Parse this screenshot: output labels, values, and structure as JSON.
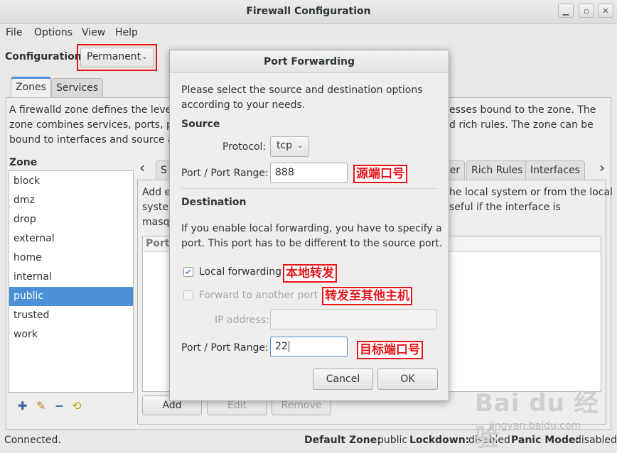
{
  "window": {
    "title": "Firewall Configuration"
  },
  "menu": [
    "File",
    "Options",
    "View",
    "Help"
  ],
  "configuration": {
    "label": "Configuration:",
    "value": "Permanent"
  },
  "tabs": [
    "Zones",
    "Services"
  ],
  "zone_description": [
    "A firewalld zone defines the level",
    "zone combines services, ports, pro",
    "bound to interfaces and source add"
  ],
  "zone_description_right": [
    "esses bound to the zone. The",
    "d rich rules. The zone can be"
  ],
  "zone_panel": {
    "title": "Zone",
    "items": [
      "block",
      "dmz",
      "drop",
      "external",
      "home",
      "internal",
      "public",
      "trusted",
      "work"
    ],
    "selected": "public"
  },
  "subtabs": {
    "first": "S",
    "partial": "cer",
    "rich_rules": "Rich Rules",
    "interfaces": "Interfaces"
  },
  "right_panel": {
    "left_text": [
      "Add e",
      "syster",
      "masqu"
    ],
    "right_text": [
      "he local system or from the local",
      "seful if the interface is"
    ],
    "column": "Port"
  },
  "bottom_buttons": {
    "add": "Add",
    "edit": "Edit",
    "remove": "Remove"
  },
  "status": {
    "text": "Connected.",
    "default_zone_label": "Default Zone:",
    "default_zone": "public",
    "lockdown_label": "Lockdown:",
    "lockdown": "disabled",
    "panic_label": "Panic Mode:",
    "panic": "disabled"
  },
  "dialog": {
    "title": "Port Forwarding",
    "intro": [
      "Please select the source and destination options",
      "according to your needs."
    ],
    "source_heading": "Source",
    "protocol_label": "Protocol:",
    "protocol_value": "tcp",
    "port_label": "Port / Port Range:",
    "source_port": "888",
    "destination_heading": "Destination",
    "dest_text": [
      "If you enable local forwarding, you have to specify a",
      "port. This port has to be different to the source port."
    ],
    "local_forwarding_label": "Local forwarding",
    "local_forwarding_checked": true,
    "forward_other_label": "Forward to another port",
    "ip_label": "IP address:",
    "ip_value": "",
    "dest_port_label": "Port / Port Range:",
    "dest_port": "22",
    "cancel": "Cancel",
    "ok": "OK"
  },
  "annotations": {
    "source_port": "源端口号",
    "local_forwarding": "本地转发",
    "forward_other": "转发至其他主机",
    "dest_port": "目标端口号"
  },
  "watermark": {
    "main": "Bai du 经验",
    "sub": "jingyan.baidu.com"
  },
  "icons": {
    "add": "plus-icon",
    "edit": "edit-icon",
    "remove": "minus-icon",
    "load": "load-defaults-icon"
  },
  "colors": {
    "accent": "#4a90d9",
    "annotation_red": "#e8151b"
  }
}
